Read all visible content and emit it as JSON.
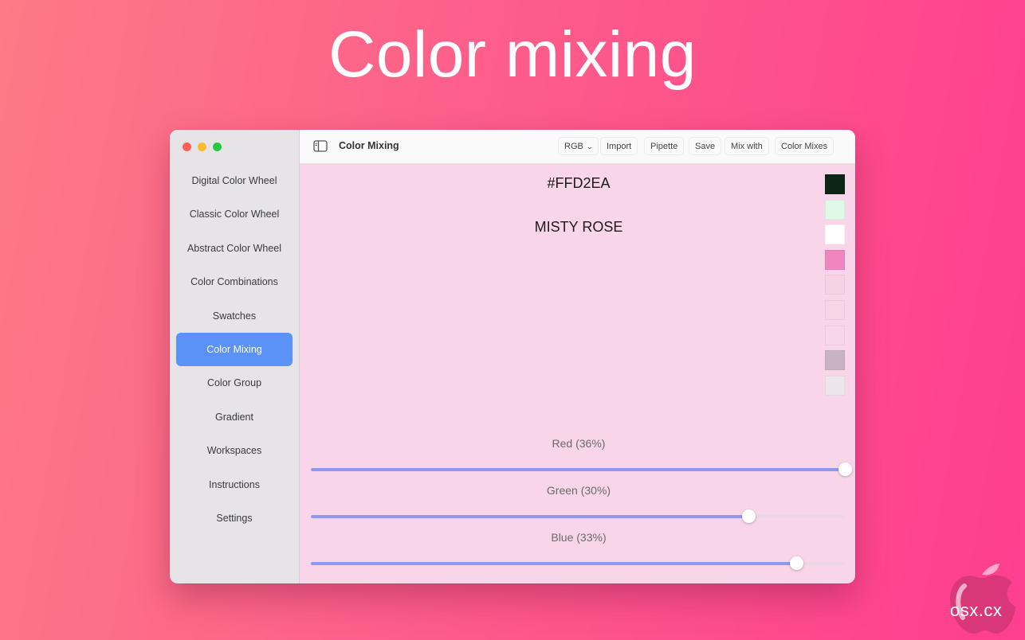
{
  "headline": "Color mixing",
  "window": {
    "title": "Color Mixing",
    "toolbar": {
      "mode_label": "RGB",
      "import_label": "Import",
      "pipette_label": "Pipette",
      "save_label": "Save",
      "mix_with_label": "Mix with",
      "color_mixes_label": "Color Mixes"
    },
    "sidebar": {
      "items": [
        {
          "label": "Digital Color Wheel"
        },
        {
          "label": "Classic Color Wheel"
        },
        {
          "label": "Abstract Color Wheel"
        },
        {
          "label": "Color Combinations"
        },
        {
          "label": "Swatches"
        },
        {
          "label": "Color Mixing",
          "active": true
        },
        {
          "label": "Color Group"
        },
        {
          "label": "Gradient"
        },
        {
          "label": "Workspaces"
        },
        {
          "label": "Instructions"
        },
        {
          "label": "Settings"
        }
      ]
    },
    "color": {
      "hex": "#FFD2EA",
      "name": "MISTY ROSE",
      "background": "#f8d5e8"
    },
    "swatches": [
      "#0b2615",
      "#defae6",
      "#ffffff",
      "#ef86c0",
      "#f7d2e5",
      "#f8d4e7",
      "#f8d6e9",
      "#c8b3c4",
      "#ece6ea"
    ],
    "sliders": [
      {
        "label": "Red (36%)",
        "value": 1.0
      },
      {
        "label": "Green (30%)",
        "value": 0.82
      },
      {
        "label": "Blue (33%)",
        "value": 0.91
      }
    ]
  },
  "watermark": {
    "text": "osx.cx"
  },
  "colors": {
    "accent": "#5b92f8",
    "slider_fill": "#8c9bee",
    "traffic_red": "#fe5f57",
    "traffic_yellow": "#febc2e",
    "traffic_green": "#28c840"
  }
}
